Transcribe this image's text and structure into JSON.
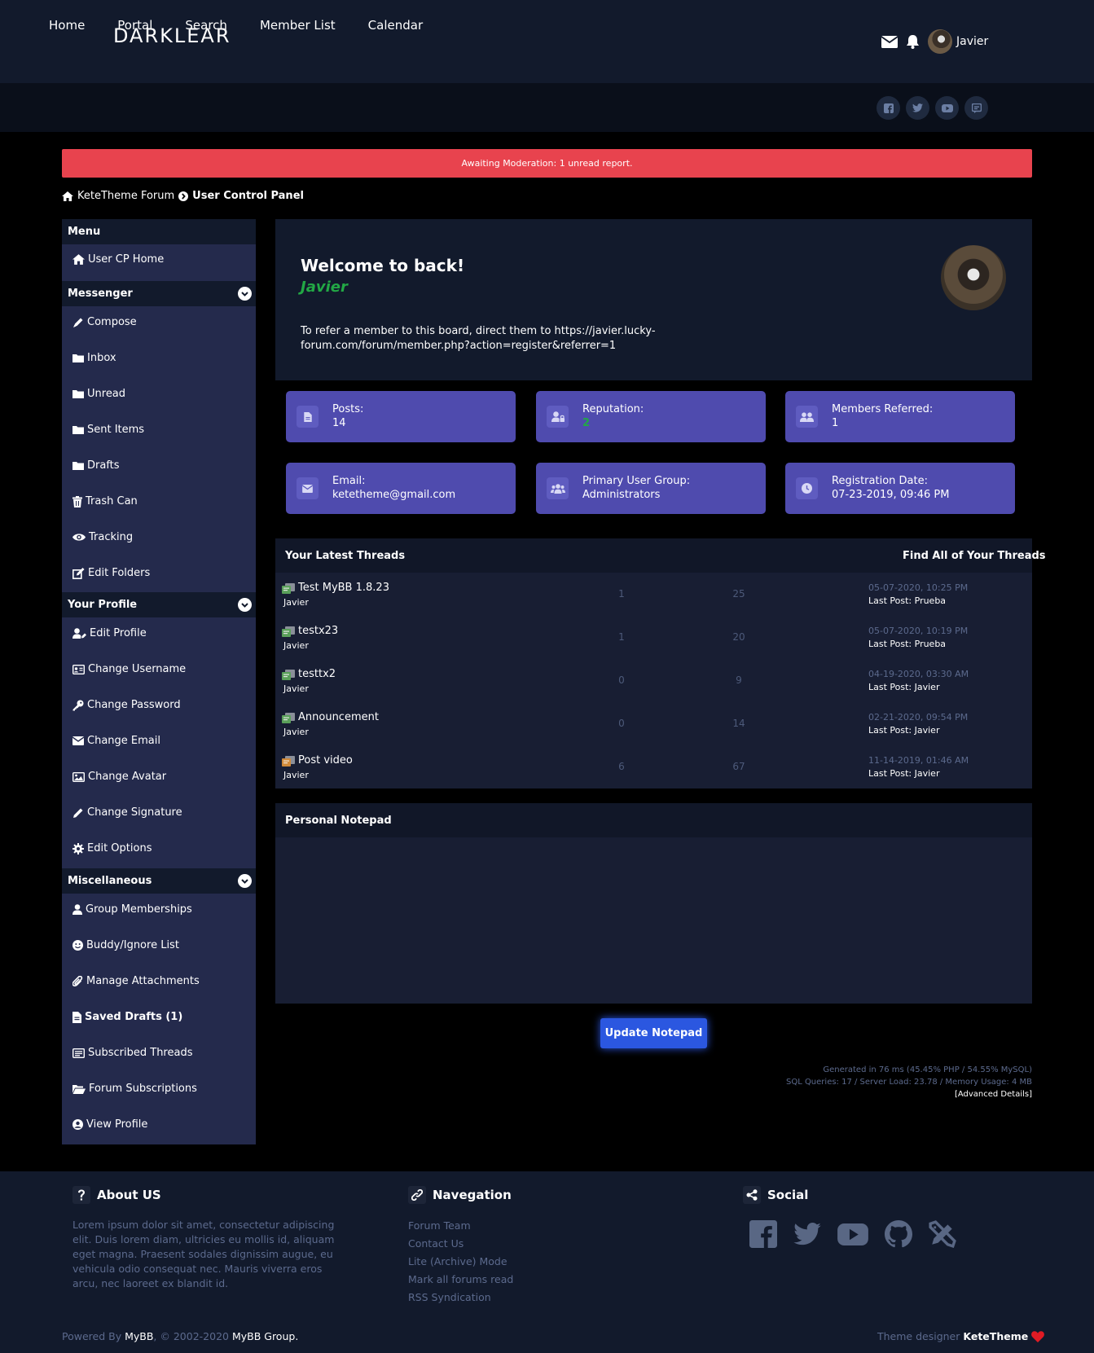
{
  "header": {
    "brand": "DARKLEAR",
    "username": "Javier"
  },
  "nav": {
    "items": [
      "Home",
      "Portal",
      "Search",
      "Member List",
      "Calendar"
    ]
  },
  "alert": {
    "text": "Awaiting Moderation: 1 unread report."
  },
  "breadcrumb": {
    "root": "KeteTheme Forum",
    "current": "User Control Panel"
  },
  "sidebar": {
    "menu_title": "Menu",
    "home": "User CP Home",
    "messenger_title": "Messenger",
    "messenger": [
      "Compose",
      "Inbox",
      "Unread",
      "Sent Items",
      "Drafts",
      "Trash Can",
      "Tracking",
      "Edit Folders"
    ],
    "profile_title": "Your Profile",
    "profile": [
      "Edit Profile",
      "Change Username",
      "Change Password",
      "Change Email",
      "Change Avatar",
      "Change Signature",
      "Edit Options"
    ],
    "misc_title": "Miscellaneous",
    "misc": [
      "Group Memberships",
      "Buddy/Ignore List",
      "Manage Attachments",
      "Saved Drafts (1)",
      "Subscribed Threads",
      "Forum Subscriptions",
      "View Profile"
    ]
  },
  "welcome": {
    "title": "Welcome to back!",
    "name": "Javier",
    "referral": "To refer a member to this board, direct them to https://javier.lucky-forum.com/forum/member.php?action=register&referrer=1"
  },
  "stats": {
    "posts_label": "Posts:",
    "posts_value": "14",
    "rep_label": "Reputation:",
    "rep_value": "2",
    "referred_label": "Members Referred:",
    "referred_value": "1",
    "email_label": "Email:",
    "email_value": "ketetheme@gmail.com",
    "group_label": "Primary User Group:",
    "group_value": "Administrators",
    "reg_label": "Registration Date:",
    "reg_value": "07-23-2019, 09:46 PM"
  },
  "threads": {
    "title": "Your Latest Threads",
    "find_all": "Find All of Your Threads",
    "rows": [
      {
        "subject": "Test MyBB 1.8.23",
        "author": "Javier",
        "replies": "1",
        "views": "25",
        "date": "05-07-2020, 10:25 PM",
        "last_post": "Last Post: Prueba"
      },
      {
        "subject": "testx23",
        "author": "Javier",
        "replies": "1",
        "views": "20",
        "date": "05-07-2020, 10:19 PM",
        "last_post": "Last Post: Prueba"
      },
      {
        "subject": "testtx2",
        "author": "Javier",
        "replies": "0",
        "views": "9",
        "date": "04-19-2020, 03:30 AM",
        "last_post": "Last Post: Javier"
      },
      {
        "subject": "Announcement",
        "author": "Javier",
        "replies": "0",
        "views": "14",
        "date": "02-21-2020, 09:54 PM",
        "last_post": "Last Post: Javier"
      },
      {
        "subject": "Post video",
        "author": "Javier",
        "replies": "6",
        "views": "67",
        "date": "11-14-2019, 01:46 AM",
        "last_post": "Last Post: Javier"
      }
    ]
  },
  "notepad": {
    "title": "Personal Notepad",
    "value": "",
    "button": "Update Notepad"
  },
  "debug": {
    "line1": "Generated in 76 ms (45.45% PHP / 54.55% MySQL)",
    "line2": "SQL Queries: 17 / Server Load: 23.78 / Memory Usage: 4 MB",
    "advanced": "Advanced Details"
  },
  "footer": {
    "about_title": "About US",
    "about_text": "Lorem ipsum dolor sit amet, consectetur adipiscing elit. Duis lorem diam, ultricies eu mollis id, aliquam eget magna. Praesent sodales dignissim augue, eu vehicula odio consequat nec. Mauris viverra eros arcu, nec laoreet ex blandit id.",
    "nav_title": "Navegation",
    "nav_links": [
      "Forum Team",
      "Contact Us",
      "Lite (Archive) Mode",
      "Mark all forums read",
      "RSS Syndication"
    ],
    "social_title": "Social",
    "powered_prefix": "Powered By ",
    "powered_mybb": "MyBB",
    "powered_mid": ", © 2002-2020 ",
    "powered_group": "MyBB Group.",
    "designer_prefix": "Theme designer ",
    "designer_name": "KeteTheme"
  },
  "colors": {
    "accent": "#4f4bae",
    "alert": "#e8434e",
    "button": "#2b57e0",
    "username_green": "#22a845"
  }
}
